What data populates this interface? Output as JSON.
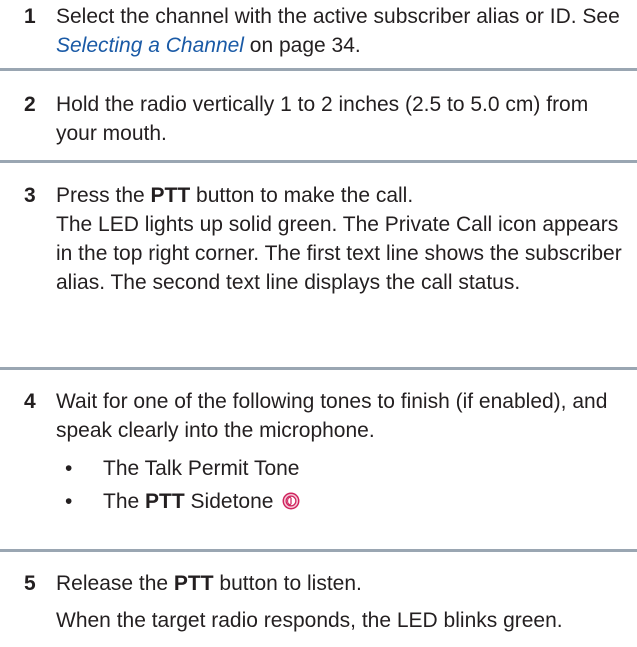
{
  "steps": [
    {
      "number": "1",
      "text_before": "Select the channel with the active subscriber alias or ID. See ",
      "link": "Selecting a Channel",
      "text_after": " on page 34."
    },
    {
      "number": "2",
      "text": "Hold the radio vertically 1 to 2 inches (2.5 to 5.0 cm) from your mouth."
    },
    {
      "number": "3",
      "line1_before": "Press the ",
      "line1_bold": "PTT",
      "line1_after": " button to make the call.",
      "line2": "The LED lights up solid green. The Private Call icon appears in the top right corner. The first text line shows the subscriber alias. The second text line displays the call status."
    },
    {
      "number": "4",
      "text": "Wait for one of the following tones to finish (if enabled), and speak clearly into the microphone.",
      "bullet1": "The Talk Permit Tone",
      "bullet2_before": "The ",
      "bullet2_bold": "PTT",
      "bullet2_after": " Sidetone",
      "bullet_glyph_1": "•",
      "bullet_glyph_2": "•",
      "icon": "sidetone-icon"
    },
    {
      "number": "5",
      "line1_before": "Release the ",
      "line1_bold": "PTT",
      "line1_after": " button to listen.",
      "line2": "When the target radio responds, the LED blinks green."
    }
  ],
  "colors": {
    "text": "#231f20",
    "link": "#1a5aa6",
    "divider": "#9aa6b2",
    "icon": "#d0245e"
  }
}
